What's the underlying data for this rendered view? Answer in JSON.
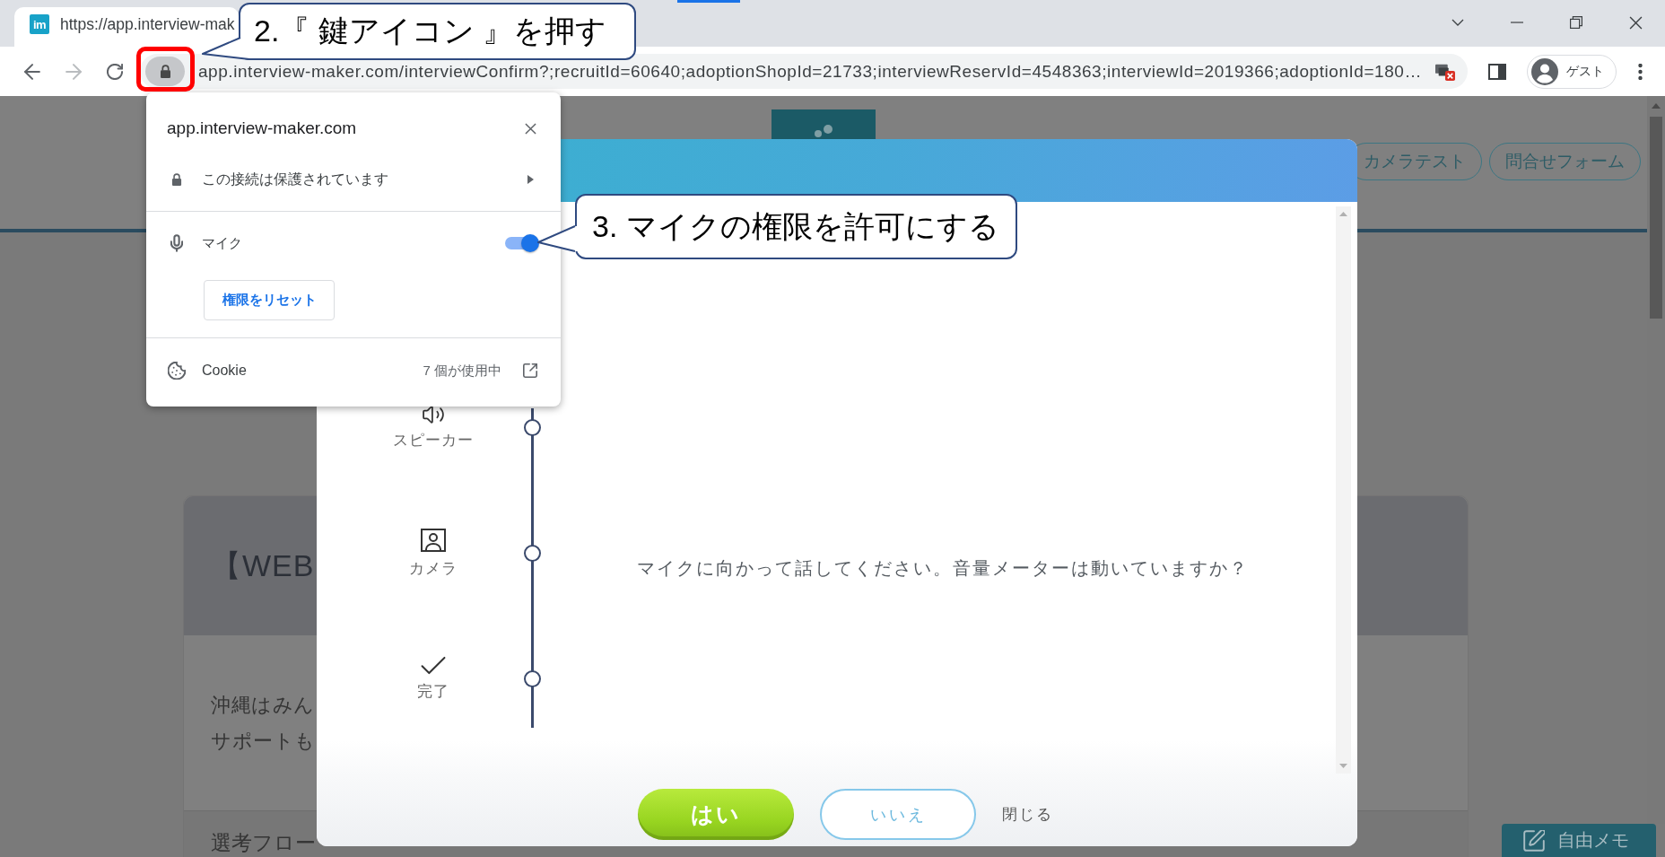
{
  "browser": {
    "tab": {
      "favicon_text": "im",
      "title": "https://app.interview-mak"
    },
    "forward_button": {
      "disabled": true
    },
    "address_bar": {
      "url": "app.interview-maker.com/interviewConfirm?;recruitId=60640;adoptionShopId=21733;interviewReservId=4548363;interviewId=2019366;adoptionId=180…"
    },
    "profile": {
      "label": "ゲスト"
    }
  },
  "page": {
    "header_buttons": [
      "カメラテスト",
      "問合せフォーム"
    ],
    "card": {
      "title": "【WEB",
      "lines": [
        "沖縄はみん",
        "サポートも"
      ],
      "section_title": "選考フロー"
    },
    "memo_button": "自由メモ"
  },
  "modal": {
    "steps": [
      {
        "label": "スピーカー"
      },
      {
        "label": "カメラ"
      },
      {
        "label": "完了"
      }
    ],
    "message": "マイクに向かって話してください。音量メーターは動いていますか？",
    "buttons": [
      {
        "label": "はい",
        "kind": "primary"
      },
      {
        "label": "いいえ",
        "kind": "secondary"
      },
      {
        "label": "閉じる",
        "kind": "link"
      }
    ]
  },
  "site_info_popup": {
    "domain": "app.interview-maker.com",
    "connection": "この接続は保護されています",
    "permissions": [
      {
        "label": "マイク",
        "on": true
      }
    ],
    "reset_button": "権限をリセット",
    "cookies": {
      "label": "Cookie",
      "count": "7 個が使用中"
    }
  },
  "callouts": [
    {
      "text": "2.『 鍵アイコン 』を押す"
    },
    {
      "text": "3. マイクの権限を許可にする"
    }
  ]
}
